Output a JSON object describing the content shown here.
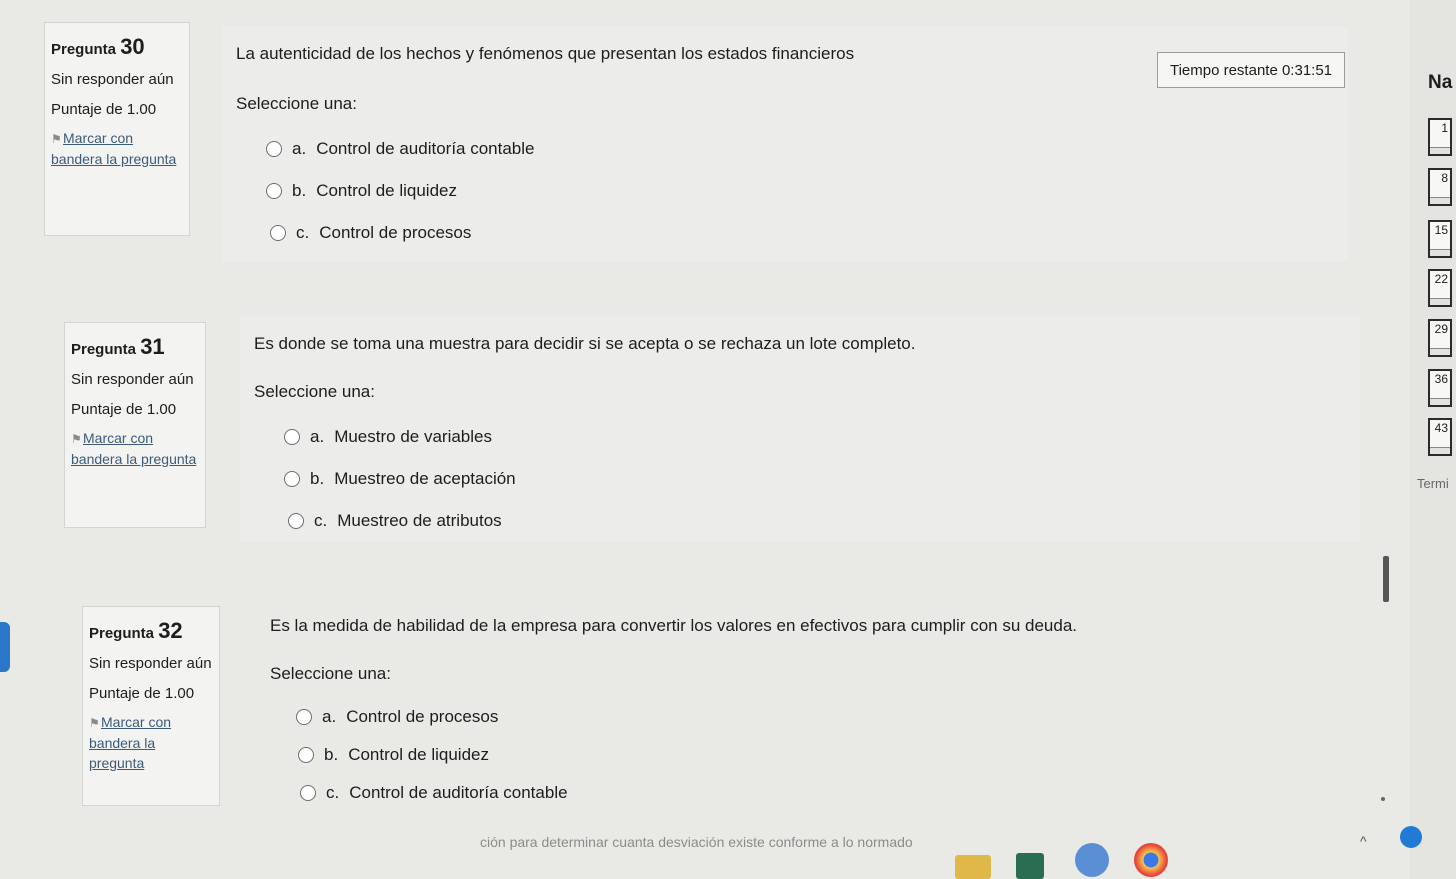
{
  "timer": {
    "label": "Tiempo restante 0:31:51"
  },
  "questions": [
    {
      "title_prefix": "Pregunta",
      "number": "30",
      "state": "Sin responder aún",
      "grade": "Puntaje de 1.00",
      "flag": "Marcar con bandera la pregunta",
      "text": "La autenticidad de los hechos y fenómenos que presentan los estados financieros",
      "prompt": "Seleccione una:",
      "answers": [
        {
          "letter": "a.",
          "text": "Control de auditoría contable"
        },
        {
          "letter": "b.",
          "text": "Control de liquidez"
        },
        {
          "letter": "c.",
          "text": "Control de procesos"
        }
      ]
    },
    {
      "title_prefix": "Pregunta",
      "number": "31",
      "state": "Sin responder aún",
      "grade": "Puntaje de 1.00",
      "flag": "Marcar con bandera la pregunta",
      "text": "Es donde se toma una muestra para decidir si se acepta o se rechaza un lote completo.",
      "prompt": "Seleccione una:",
      "answers": [
        {
          "letter": "a.",
          "text": "Muestro de variables"
        },
        {
          "letter": "b.",
          "text": "Muestreo de aceptación"
        },
        {
          "letter": "c.",
          "text": "Muestreo de atributos"
        }
      ]
    },
    {
      "title_prefix": "Pregunta",
      "number": "32",
      "state": "Sin responder aún",
      "grade": "Puntaje de 1.00",
      "flag": "Marcar con bandera la pregunta",
      "text": "Es la medida de habilidad de la empresa para convertir los valores en efectivos para cumplir con su deuda.",
      "prompt": "Seleccione una:",
      "answers": [
        {
          "letter": "a.",
          "text": "Control de procesos"
        },
        {
          "letter": "b.",
          "text": "Control de liquidez"
        },
        {
          "letter": "c.",
          "text": "Control de auditoría contable"
        }
      ]
    }
  ],
  "navigation": {
    "title": "Na",
    "buttons": [
      "1",
      "8",
      "15",
      "22",
      "29",
      "36",
      "43"
    ],
    "finish": "Termi"
  },
  "bottom_text": "ción para determinar cuanta desviación existe conforme a lo normado"
}
